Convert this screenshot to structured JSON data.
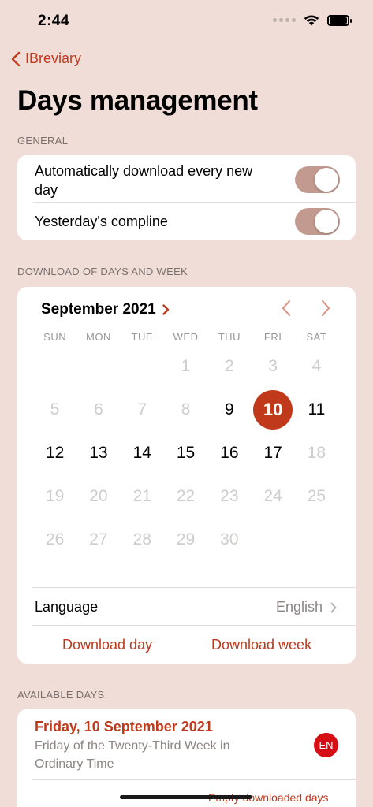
{
  "status_bar": {
    "time": "2:44"
  },
  "nav": {
    "back_label": "IBreviary",
    "title": "Days management"
  },
  "general": {
    "header": "GENERAL",
    "settings": [
      {
        "label": "Automatically download every new day",
        "on": true
      },
      {
        "label": "Yesterday's compline",
        "on": true
      }
    ]
  },
  "download": {
    "header": "DOWNLOAD OF DAYS AND WEEK",
    "calendar": {
      "month": "September 2021",
      "weekdays": [
        "SUN",
        "MON",
        "TUE",
        "WED",
        "THU",
        "FRI",
        "SAT"
      ],
      "selected_day": "10",
      "weeks": [
        [
          null,
          null,
          null,
          {
            "d": "1",
            "s": "disabled"
          },
          {
            "d": "2",
            "s": "disabled"
          },
          {
            "d": "3",
            "s": "disabled"
          },
          {
            "d": "4",
            "s": "disabled"
          }
        ],
        [
          {
            "d": "5",
            "s": "disabled"
          },
          {
            "d": "6",
            "s": "disabled"
          },
          {
            "d": "7",
            "s": "disabled"
          },
          {
            "d": "8",
            "s": "disabled"
          },
          {
            "d": "9",
            "s": "enabled"
          },
          {
            "d": "10",
            "s": "selected"
          },
          {
            "d": "11",
            "s": "enabled"
          }
        ],
        [
          {
            "d": "12",
            "s": "enabled"
          },
          {
            "d": "13",
            "s": "enabled"
          },
          {
            "d": "14",
            "s": "enabled"
          },
          {
            "d": "15",
            "s": "enabled"
          },
          {
            "d": "16",
            "s": "enabled"
          },
          {
            "d": "17",
            "s": "enabled"
          },
          {
            "d": "18",
            "s": "disabled"
          }
        ],
        [
          {
            "d": "19",
            "s": "disabled"
          },
          {
            "d": "20",
            "s": "disabled"
          },
          {
            "d": "21",
            "s": "disabled"
          },
          {
            "d": "22",
            "s": "disabled"
          },
          {
            "d": "23",
            "s": "disabled"
          },
          {
            "d": "24",
            "s": "disabled"
          },
          {
            "d": "25",
            "s": "disabled"
          }
        ],
        [
          {
            "d": "26",
            "s": "disabled"
          },
          {
            "d": "27",
            "s": "disabled"
          },
          {
            "d": "28",
            "s": "disabled"
          },
          {
            "d": "29",
            "s": "disabled"
          },
          {
            "d": "30",
            "s": "disabled"
          },
          null,
          null
        ]
      ]
    },
    "language_label": "Language",
    "language_value": "English",
    "download_day": "Download day",
    "download_week": "Download week"
  },
  "available": {
    "header": "AVAILABLE DAYS",
    "items": [
      {
        "title": "Friday, 10 September 2021",
        "description": "Friday of the Twenty-Third Week in Ordinary Time",
        "badge": "EN"
      }
    ],
    "empty_label": "Empty downloaded days"
  },
  "colors": {
    "accent": "#c0391b",
    "background": "#f1ddd8",
    "toggle_on": "#c29a90",
    "badge": "#d60f16"
  }
}
